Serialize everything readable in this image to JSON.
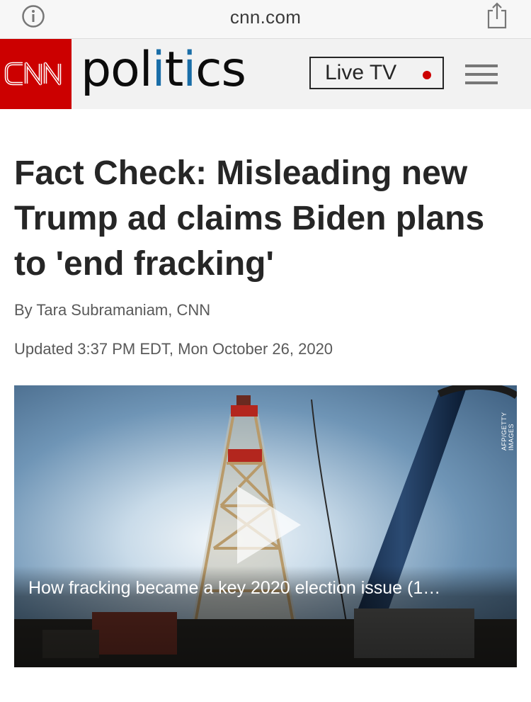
{
  "browser": {
    "url": "cnn.com",
    "info_icon": "info-circle-icon",
    "share_icon": "share-icon"
  },
  "header": {
    "logo_text": "CNN",
    "section_pre": "pol",
    "section_accent": "i",
    "section_mid": "t",
    "section_accent2": "i",
    "section_post": "cs",
    "live_tv_label": "Live TV",
    "menu_icon": "hamburger-menu-icon",
    "brand_color": "#cc0000",
    "accent_color": "#1a6ea8"
  },
  "article": {
    "headline": "Fact Check: Misleading new Trump ad claims Biden plans to 'end fracking'",
    "byline": "By Tara Subramaniam, CNN",
    "updated": "Updated 3:37 PM EDT, Mon October 26, 2020"
  },
  "video": {
    "caption": "How fracking became a key 2020 election issue (1…",
    "credit": "AFP/GETTY IMAGES",
    "play_icon": "play-icon"
  }
}
